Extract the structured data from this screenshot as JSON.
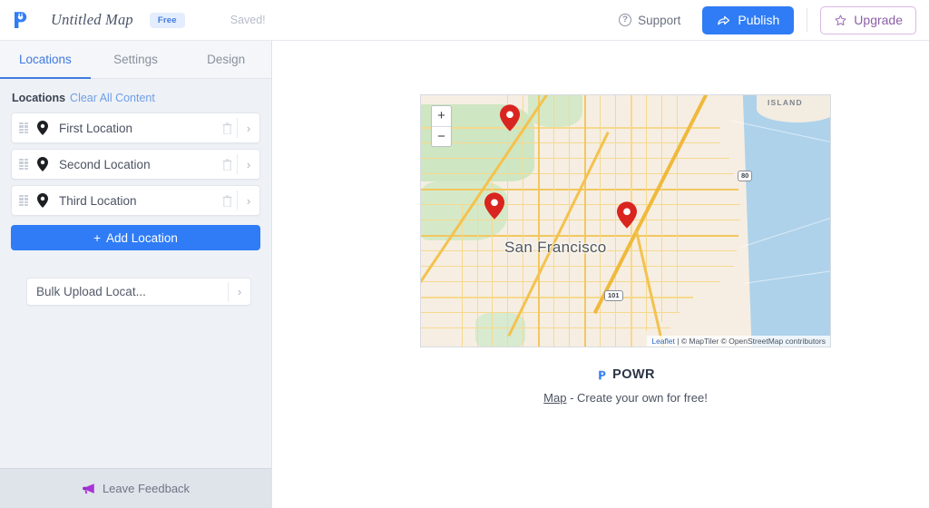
{
  "header": {
    "logo_icon": "powr-logo-icon",
    "title": "Untitled Map",
    "plan_badge": "Free",
    "save_status": "Saved!",
    "support_label": "Support",
    "support_icon": "question-circle-icon",
    "publish_label": "Publish",
    "publish_icon": "share-arrow-icon",
    "upgrade_label": "Upgrade",
    "upgrade_icon": "star-icon",
    "accent_blue": "#2f7cf6",
    "upgrade_purple": "#8b5fa8"
  },
  "sidebar": {
    "tabs": [
      {
        "label": "Locations",
        "active": true
      },
      {
        "label": "Settings",
        "active": false
      },
      {
        "label": "Design",
        "active": false
      }
    ],
    "locations_header": {
      "label": "Locations",
      "clear_label": "Clear All Content"
    },
    "locations": [
      {
        "name": "First Location",
        "drag_icon": "drag-handle-icon",
        "pin_icon": "map-pin-icon",
        "delete_icon": "trash-icon",
        "expand_icon": "chevron-right-icon"
      },
      {
        "name": "Second Location",
        "drag_icon": "drag-handle-icon",
        "pin_icon": "map-pin-icon",
        "delete_icon": "trash-icon",
        "expand_icon": "chevron-right-icon"
      },
      {
        "name": "Third Location",
        "drag_icon": "drag-handle-icon",
        "pin_icon": "map-pin-icon",
        "delete_icon": "trash-icon",
        "expand_icon": "chevron-right-icon"
      }
    ],
    "add_location_label": "Add Location",
    "add_location_icon": "plus-icon",
    "bulk_upload_label": "Bulk Upload Locat...",
    "bulk_upload_icon": "chevron-right-icon",
    "feedback_label": "Leave Feedback",
    "feedback_icon": "megaphone-icon"
  },
  "map": {
    "zoom_in_label": "+",
    "zoom_out_label": "−",
    "city_label": "San Francisco",
    "island_label": "ISLAND",
    "highway_shields": [
      "80",
      "101"
    ],
    "marker_count": 3,
    "marker_color": "#d9241f",
    "attribution": {
      "leaflet": "Leaflet",
      "separator": "|",
      "providers": "© MapTiler © OpenStreetMap contributors"
    }
  },
  "credit": {
    "brand": "POWR",
    "brand_icon": "powr-logo-icon",
    "link_label": "Map",
    "tagline": "- Create your own for free!"
  }
}
